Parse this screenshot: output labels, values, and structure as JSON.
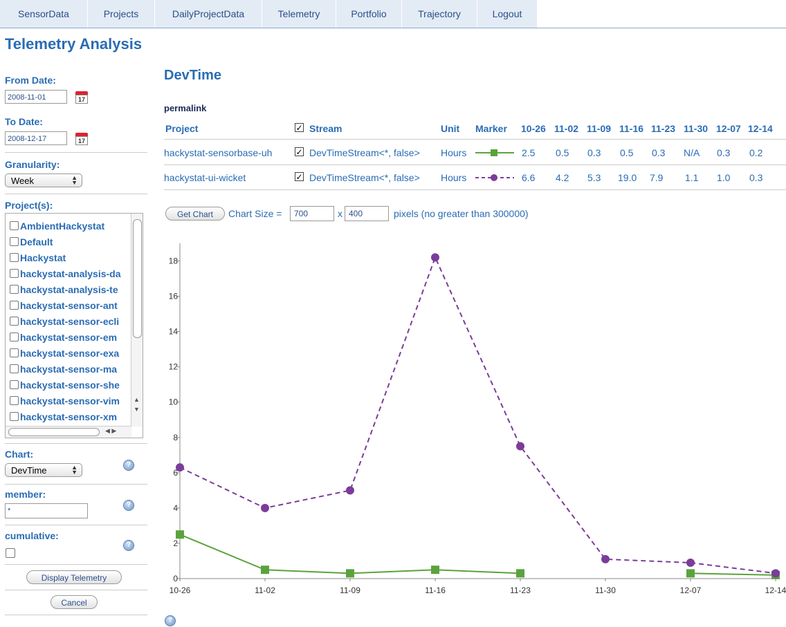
{
  "nav": {
    "tabs": [
      "SensorData",
      "Projects",
      "DailyProjectData",
      "Telemetry",
      "Portfolio",
      "Trajectory",
      "Logout"
    ]
  },
  "page_title": "Telemetry Analysis",
  "left": {
    "from_label": "From Date:",
    "from_value": "2008-11-01",
    "to_label": "To Date:",
    "to_value": "2008-12-17",
    "cal_day": "17",
    "granularity_label": "Granularity:",
    "granularity_value": "Week",
    "projects_label": "Project(s):",
    "projects": [
      "AmbientHackystat",
      "Default",
      "Hackystat",
      "hackystat-analysis-da",
      "hackystat-analysis-te",
      "hackystat-sensor-ant",
      "hackystat-sensor-ecli",
      "hackystat-sensor-em",
      "hackystat-sensor-exa",
      "hackystat-sensor-ma",
      "hackystat-sensor-she",
      "hackystat-sensor-vim",
      "hackystat-sensor-xm"
    ],
    "chart_label": "Chart:",
    "chart_value": "DevTime",
    "member_label": "member:",
    "member_value": "*",
    "cumulative_label": "cumulative:",
    "display_button": "Display Telemetry",
    "cancel_button": "Cancel"
  },
  "main": {
    "title": "DevTime",
    "permalink": "permalink",
    "headers": {
      "project": "Project",
      "stream": "Stream",
      "unit": "Unit",
      "marker": "Marker"
    },
    "dates": [
      "10-26",
      "11-02",
      "11-09",
      "11-16",
      "11-23",
      "11-30",
      "12-07",
      "12-14"
    ],
    "rows": [
      {
        "project": "hackystat-sensorbase-uh",
        "stream": "DevTimeStream<*, false>",
        "unit": "Hours",
        "values": [
          "2.5",
          "0.5",
          "0.3",
          "0.5",
          "0.3",
          "N/A",
          "0.3",
          "0.2"
        ]
      },
      {
        "project": "hackystat-ui-wicket",
        "stream": "DevTimeStream<*, false>",
        "unit": "Hours",
        "values": [
          "6.6",
          "4.2",
          "5.3",
          "19.0",
          "7.9",
          "1.1",
          "1.0",
          "0.3"
        ]
      }
    ],
    "get_chart": "Get Chart",
    "chart_size_label": "Chart Size =",
    "width_value": "700",
    "x_label": "x",
    "height_value": "400",
    "pixels_label": "pixels (no greater than 300000)"
  },
  "chart_data": {
    "type": "line",
    "categories": [
      "10-26",
      "11-02",
      "11-09",
      "11-16",
      "11-23",
      "11-30",
      "12-07",
      "12-14"
    ],
    "series": [
      {
        "name": "hackystat-sensorbase-uh",
        "values": [
          2.5,
          0.5,
          0.3,
          0.5,
          0.3,
          null,
          0.3,
          0.2
        ],
        "color": "#5aa33c",
        "style": "solid",
        "marker": "square"
      },
      {
        "name": "hackystat-ui-wicket",
        "values": [
          6.3,
          4.0,
          5.0,
          18.2,
          7.5,
          1.1,
          0.9,
          0.3
        ],
        "color": "#7b3c9a",
        "style": "dashed",
        "marker": "circle"
      }
    ],
    "yticks": [
      0,
      2,
      4,
      6,
      8,
      10,
      12,
      14,
      16,
      18
    ],
    "ylim": [
      0,
      19
    ],
    "grid": false
  }
}
